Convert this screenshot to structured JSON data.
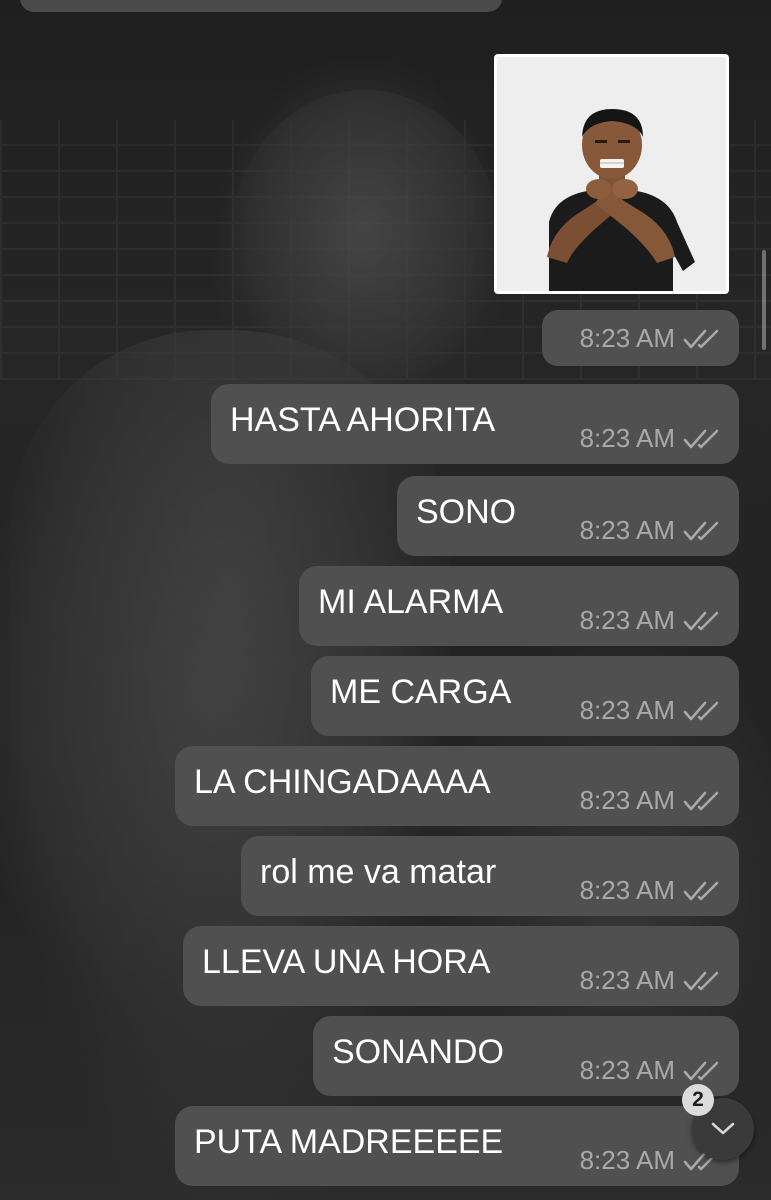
{
  "chat": {
    "photo_message": {
      "time": "8:23 AM"
    },
    "messages": [
      {
        "text": "HASTA AHORITA",
        "time": "8:23 AM"
      },
      {
        "text": "SONO",
        "time": "8:23 AM"
      },
      {
        "text": "MI ALARMA",
        "time": "8:23 AM"
      },
      {
        "text": "ME CARGA",
        "time": "8:23 AM"
      },
      {
        "text": "LA CHINGADAAAA",
        "time": "8:23 AM"
      },
      {
        "text": "rol me va matar",
        "time": "8:23 AM"
      },
      {
        "text": "LLEVA UNA HORA",
        "time": "8:23 AM"
      },
      {
        "text": "SONANDO",
        "time": "8:23 AM"
      },
      {
        "text": "PUTA MADREEEEE",
        "time": "8:23 AM"
      }
    ]
  },
  "scroll_button": {
    "unread_count": "2",
    "icon": "chevron-down-icon"
  },
  "colors": {
    "bubble": "#505050",
    "text": "#ffffff",
    "time_text": "#a9a9a9"
  }
}
